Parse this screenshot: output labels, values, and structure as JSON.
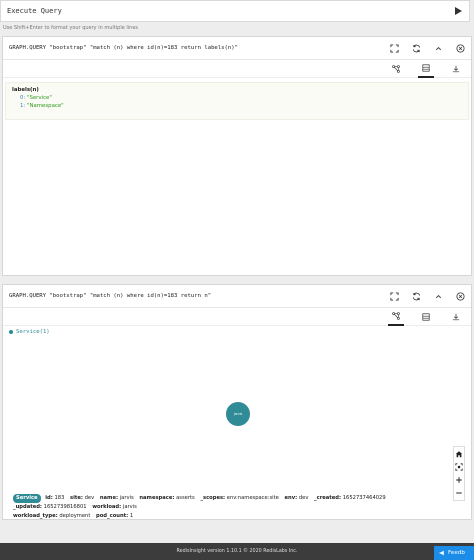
{
  "query": {
    "placeholder": "Execute Query",
    "hint": "Use Shift+Enter to format your query in multiple lines"
  },
  "results": [
    {
      "command": "GRAPH.QUERY \"bootstrap\" \"match (n) where id(n)=183 return labels(n)\"",
      "title": "labels(n)",
      "rows": [
        {
          "index": "0:",
          "value": "\"Service\""
        },
        {
          "index": "1:",
          "value": "\"Namespace\""
        }
      ]
    },
    {
      "command": "GRAPH.QUERY \"bootstrap\" \"match (n) where id(n)=183 return n\"",
      "legend": "Service(1)",
      "node_label": "jarvis",
      "badge": "Service",
      "properties": [
        {
          "key": "id:",
          "value": "183"
        },
        {
          "key": "site:",
          "value": "dev"
        },
        {
          "key": "name:",
          "value": "jarvis"
        },
        {
          "key": "namespace:",
          "value": "asserts"
        },
        {
          "key": "_scopes:",
          "value": "env:namespace:site"
        },
        {
          "key": "env:",
          "value": "dev"
        },
        {
          "key": "_created:",
          "value": "1652737464029"
        },
        {
          "key": "_updated:",
          "value": "1652739816801"
        },
        {
          "key": "workload:",
          "value": "jarvis"
        },
        {
          "key": "workload_type:",
          "value": "deployment"
        },
        {
          "key": "pod_count:",
          "value": "1"
        }
      ]
    }
  ],
  "footer": {
    "text": "RedisInsight version 1.10.1 © 2020 RedisLabs Inc.",
    "feedback": "Feedb"
  },
  "colors": {
    "node": "#2f8b96",
    "feedback": "#1b8ce8"
  }
}
